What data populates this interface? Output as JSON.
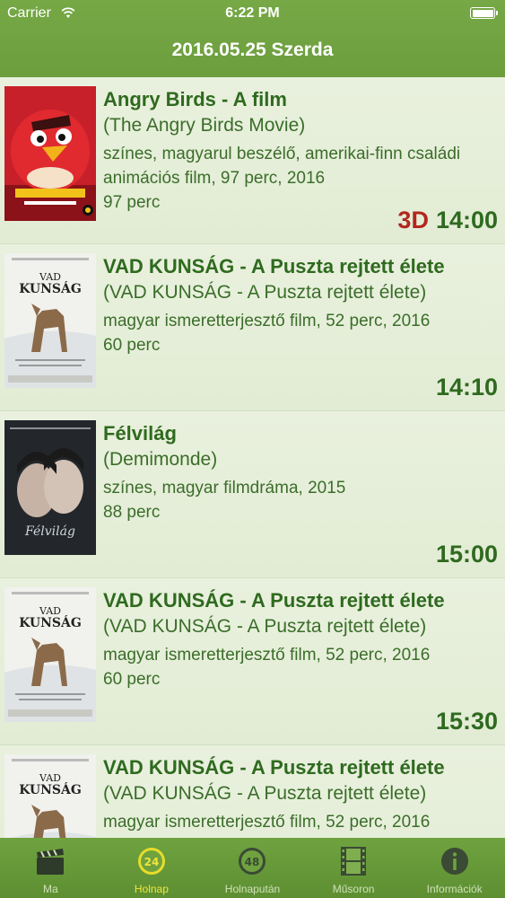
{
  "status_bar": {
    "carrier": "Carrier",
    "time": "6:22 PM"
  },
  "nav": {
    "title": "2016.05.25 Szerda"
  },
  "movies": [
    {
      "title": "Angry Birds - A film",
      "original_title": "(The Angry Birds Movie)",
      "description": "színes, magyarul beszélő, amerikai-finn családi animációs film, 97 perc, 2016",
      "duration": "97 perc",
      "badge": "3D",
      "time": "14:00",
      "poster": "angry-birds-poster"
    },
    {
      "title": "VAD KUNSÁG - A Puszta rejtett élete",
      "original_title": "(VAD KUNSÁG - A Puszta rejtett élete)",
      "description": "magyar ismeretterjesztő film, 52 perc, 2016",
      "duration": "60 perc",
      "badge": "",
      "time": "14:10",
      "poster": "vad-kunsag-poster"
    },
    {
      "title": "Félvilág",
      "original_title": "(Demimonde)",
      "description": "színes, magyar filmdráma, 2015",
      "duration": "88 perc",
      "badge": "",
      "time": "15:00",
      "poster": "felvilag-poster"
    },
    {
      "title": "VAD KUNSÁG - A Puszta rejtett élete",
      "original_title": "(VAD KUNSÁG - A Puszta rejtett élete)",
      "description": "magyar ismeretterjesztő film, 52 perc, 2016",
      "duration": "60 perc",
      "badge": "",
      "time": "15:30",
      "poster": "vad-kunsag-poster"
    },
    {
      "title": "VAD KUNSÁG - A Puszta rejtett élete",
      "original_title": "(VAD KUNSÁG - A Puszta rejtett élete)",
      "description": "magyar ismeretterjesztő film, 52 perc, 2016",
      "duration": "",
      "badge": "",
      "time": "",
      "poster": "vad-kunsag-poster"
    }
  ],
  "tabs": [
    {
      "label": "Ma",
      "icon": "clapperboard-icon",
      "active": false
    },
    {
      "label": "Holnap",
      "icon": "clock-24-icon",
      "badge": "24",
      "active": true
    },
    {
      "label": "Holnapután",
      "icon": "clock-48-icon",
      "badge": "48",
      "active": false
    },
    {
      "label": "Műsoron",
      "icon": "film-strip-icon",
      "active": false
    },
    {
      "label": "Információk",
      "icon": "info-icon",
      "active": false
    }
  ],
  "colors": {
    "header": "#6fa23f",
    "title_text": "#2f6a1f",
    "body_text": "#3b6d2a",
    "badge_3d": "#b3261e",
    "active_tab": "#f2e43a"
  }
}
